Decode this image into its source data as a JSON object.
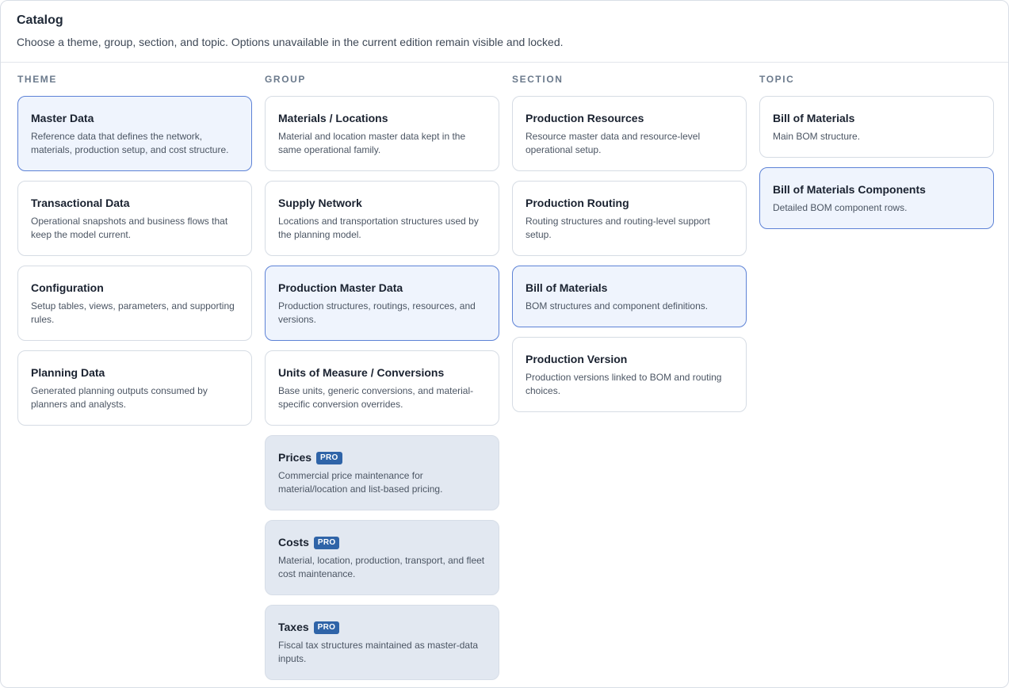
{
  "header": {
    "title": "Catalog",
    "subtitle": "Choose a theme, group, section, and topic. Options unavailable in the current edition remain visible and locked."
  },
  "colors": {
    "selected_border": "#5d82d6",
    "selected_bg": "#eff4fd",
    "locked_bg": "#e2e8f1",
    "badge": "#2f64a8"
  },
  "columns": {
    "theme": {
      "label": "THEME",
      "items": [
        {
          "title": "Master Data",
          "desc": "Reference data that defines the network, materials, production setup, and cost structure."
        },
        {
          "title": "Transactional Data",
          "desc": "Operational snapshots and business flows that keep the model current."
        },
        {
          "title": "Configuration",
          "desc": "Setup tables, views, parameters, and supporting rules."
        },
        {
          "title": "Planning Data",
          "desc": "Generated planning outputs consumed by planners and analysts."
        }
      ]
    },
    "group": {
      "label": "GROUP",
      "items": [
        {
          "title": "Materials / Locations",
          "desc": "Material and location master data kept in the same operational family."
        },
        {
          "title": "Supply Network",
          "desc": "Locations and transportation structures used by the planning model."
        },
        {
          "title": "Production Master Data",
          "desc": "Production structures, routings, resources, and versions."
        },
        {
          "title": "Units of Measure / Conversions",
          "desc": "Base units, generic conversions, and material-specific conversion overrides."
        },
        {
          "title": "Prices",
          "badge": "PRO",
          "desc": "Commercial price maintenance for material/location and list-based pricing."
        },
        {
          "title": "Costs",
          "badge": "PRO",
          "desc": "Material, location, production, transport, and fleet cost maintenance."
        },
        {
          "title": "Taxes",
          "badge": "PRO",
          "desc": "Fiscal tax structures maintained as master-data inputs."
        }
      ]
    },
    "section": {
      "label": "SECTION",
      "items": [
        {
          "title": "Production Resources",
          "desc": "Resource master data and resource-level operational setup."
        },
        {
          "title": "Production Routing",
          "desc": "Routing structures and routing-level support setup."
        },
        {
          "title": "Bill of Materials",
          "desc": "BOM structures and component definitions."
        },
        {
          "title": "Production Version",
          "desc": "Production versions linked to BOM and routing choices."
        }
      ]
    },
    "topic": {
      "label": "TOPIC",
      "items": [
        {
          "title": "Bill of Materials",
          "desc": "Main BOM structure."
        },
        {
          "title": "Bill of Materials Components",
          "desc": "Detailed BOM component rows."
        }
      ]
    }
  }
}
